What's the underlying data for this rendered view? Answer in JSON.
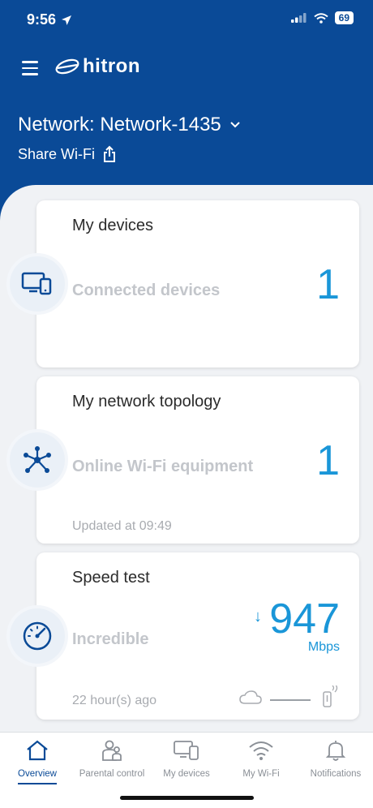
{
  "status_bar": {
    "time": "9:56",
    "battery": "69"
  },
  "header": {
    "logo_text": "hitron",
    "network_label": "Network: Network-1435",
    "share_label": "Share Wi-Fi"
  },
  "cards": {
    "devices": {
      "title": "My devices",
      "subtitle": "Connected devices",
      "value": "1"
    },
    "topology": {
      "title": "My network topology",
      "subtitle": "Online Wi-Fi equipment",
      "value": "1",
      "updated": "Updated at 09:49"
    },
    "speed": {
      "title": "Speed test",
      "subtitle": "Incredible",
      "value": "947",
      "unit": "Mbps",
      "ago": "22 hour(s) ago"
    }
  },
  "tabs": [
    {
      "label": "Overview",
      "icon": "home-icon",
      "active": true
    },
    {
      "label": "Parental control",
      "icon": "parental-icon",
      "active": false
    },
    {
      "label": "My devices",
      "icon": "devices-icon",
      "active": false
    },
    {
      "label": "My Wi-Fi",
      "icon": "wifi-icon",
      "active": false
    },
    {
      "label": "Notifications",
      "icon": "bell-icon",
      "active": false
    }
  ],
  "colors": {
    "brand": "#0a4a97",
    "accent": "#1a96d8"
  }
}
